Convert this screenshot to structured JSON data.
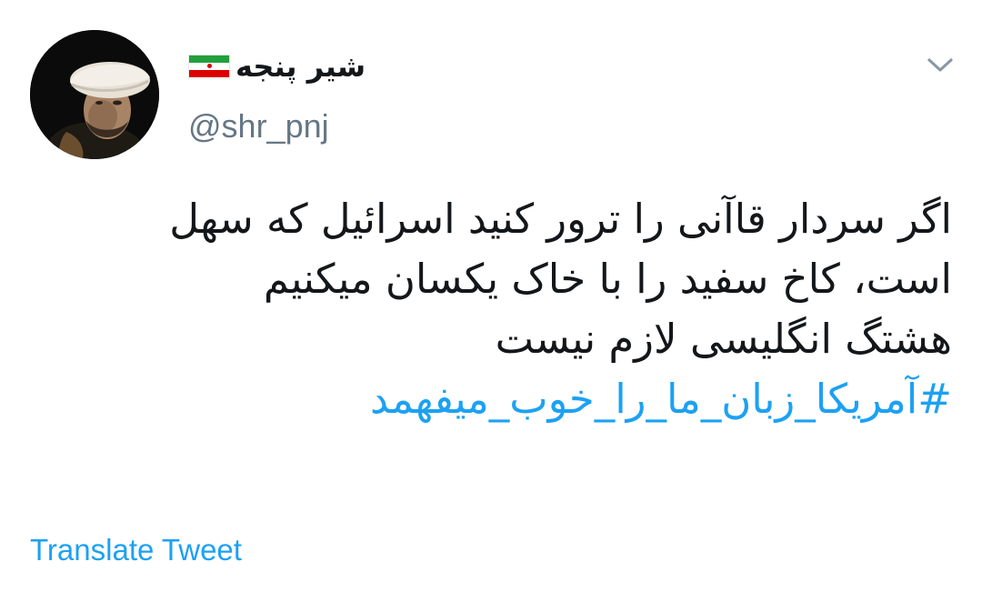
{
  "user": {
    "display_name": "شیر پنجه",
    "handle": "@shr_pnj",
    "avatar_icon": "profile-photo",
    "flag_icon": "iran-flag-icon"
  },
  "menu": {
    "icon": "chevron-down-icon"
  },
  "tweet": {
    "lines": [
      "اگر سردار قاآنی را ترور کنید اسرائیل که سهل",
      "است، کاخ سفید را با خاک یکسان میکنیم",
      "هشتگ انگلیسی لازم نیست"
    ],
    "hashtag": "#آمریکا_زبان_ما_را_خوب_میفهمد"
  },
  "actions": {
    "translate_label": "Translate Tweet"
  },
  "colors": {
    "link": "#1da1f2",
    "text": "#14171a",
    "secondary": "#657786"
  }
}
